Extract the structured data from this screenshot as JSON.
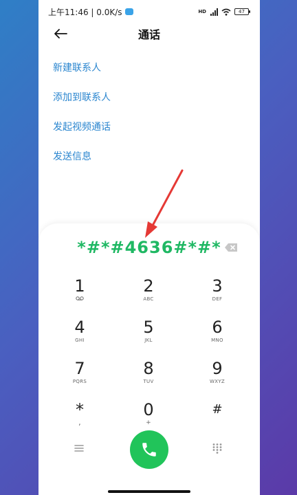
{
  "status_bar": {
    "time_speed": "上午11:46 | 0.0K/s",
    "network": "HD",
    "battery": "47"
  },
  "header": {
    "title": "通话"
  },
  "options": [
    {
      "label": "新建联系人"
    },
    {
      "label": "添加到联系人"
    },
    {
      "label": "发起视频通话"
    },
    {
      "label": "发送信息"
    }
  ],
  "dialer": {
    "dialed_number": "*#*#4636#*#*",
    "keys": [
      {
        "digit": "1",
        "letters": "ᴑᴑ"
      },
      {
        "digit": "2",
        "letters": "ABC"
      },
      {
        "digit": "3",
        "letters": "DEF"
      },
      {
        "digit": "4",
        "letters": "GHI"
      },
      {
        "digit": "5",
        "letters": "JKL"
      },
      {
        "digit": "6",
        "letters": "MNO"
      },
      {
        "digit": "7",
        "letters": "PQRS"
      },
      {
        "digit": "8",
        "letters": "TUV"
      },
      {
        "digit": "9",
        "letters": "WXYZ"
      },
      {
        "digit": "*",
        "letters": ","
      },
      {
        "digit": "0",
        "letters": "+"
      },
      {
        "digit": "#",
        "letters": ""
      }
    ]
  },
  "colors": {
    "accent_blue": "#2b86cf",
    "dial_green": "#1fb863",
    "call_green": "#21c45a",
    "arrow_red": "#e53935"
  },
  "icons": {
    "back": "arrow-left-icon",
    "backspace": "backspace-icon",
    "menu": "menu-icon",
    "call": "phone-icon",
    "keypad": "dialpad-icon"
  }
}
